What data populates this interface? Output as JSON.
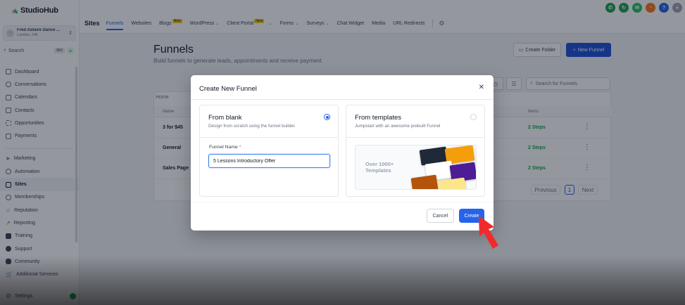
{
  "brand": {
    "name": "StudioHub"
  },
  "account": {
    "name": "Fred Astaire Dance ...",
    "location": "London, ON"
  },
  "sidebar_search": {
    "label": "Search",
    "shortcut": "⌘K"
  },
  "nav": {
    "group1": [
      {
        "label": "Dashboard",
        "icon": "dashboard-icon"
      },
      {
        "label": "Conversations",
        "icon": "chat-icon"
      },
      {
        "label": "Calendars",
        "icon": "calendar-icon"
      },
      {
        "label": "Contacts",
        "icon": "contacts-icon"
      },
      {
        "label": "Opportunities",
        "icon": "opportunities-icon"
      },
      {
        "label": "Payments",
        "icon": "payments-icon"
      }
    ],
    "group2": [
      {
        "label": "Marketing",
        "icon": "send-icon"
      },
      {
        "label": "Automation",
        "icon": "automation-icon"
      },
      {
        "label": "Sites",
        "icon": "sites-icon",
        "active": true
      },
      {
        "label": "Memberships",
        "icon": "memberships-icon"
      },
      {
        "label": "Reputation",
        "icon": "star-icon"
      },
      {
        "label": "Reporting",
        "icon": "chart-icon"
      },
      {
        "label": "Training",
        "icon": "book-icon"
      },
      {
        "label": "Support",
        "icon": "support-icon"
      },
      {
        "label": "Community",
        "icon": "community-icon"
      },
      {
        "label": "Additional Services",
        "icon": "cart-icon"
      }
    ],
    "settings": "Settings"
  },
  "topnav": {
    "section": "Sites",
    "items": [
      "Funnels",
      "Websites",
      "Blogs",
      "WordPress",
      "Client Portal",
      "Forms",
      "Surveys",
      "Chat Widget",
      "Media",
      "URL Redirects"
    ],
    "new_tag": "New"
  },
  "page": {
    "title": "Funnels",
    "subtitle": "Build funnels to generate leads, appointments and receive payment",
    "create_folder": "Create Folder",
    "new_funnel": "New Funnel",
    "search_placeholder": "Search for Funnels",
    "breadcrumb": "Home",
    "columns": {
      "name": "Name",
      "items": "Items"
    },
    "rows": [
      {
        "name": "3 for $45",
        "items": "2 Steps"
      },
      {
        "name": "General",
        "items": "2 Steps"
      },
      {
        "name": "Sales Page",
        "items": "2 Steps"
      }
    ],
    "pager": {
      "previous": "Previous",
      "current": "1",
      "next": "Next"
    }
  },
  "modal": {
    "title": "Create New Funnel",
    "blank": {
      "title": "From blank",
      "desc": "Design from scratch using the funnel builder"
    },
    "templates": {
      "title": "From templates",
      "desc": "Jumpstart with an awesome prebuilt Funnel",
      "preview_text": "Over 1000+ Templates"
    },
    "field_label": "Funnel Name",
    "field_value": "5 Lessons Introductory Offer",
    "cancel": "Cancel",
    "create": "Create"
  },
  "colors": {
    "primary": "#2563eb",
    "success": "#16a34a",
    "highlight_arrow": "#ef2b2d"
  }
}
